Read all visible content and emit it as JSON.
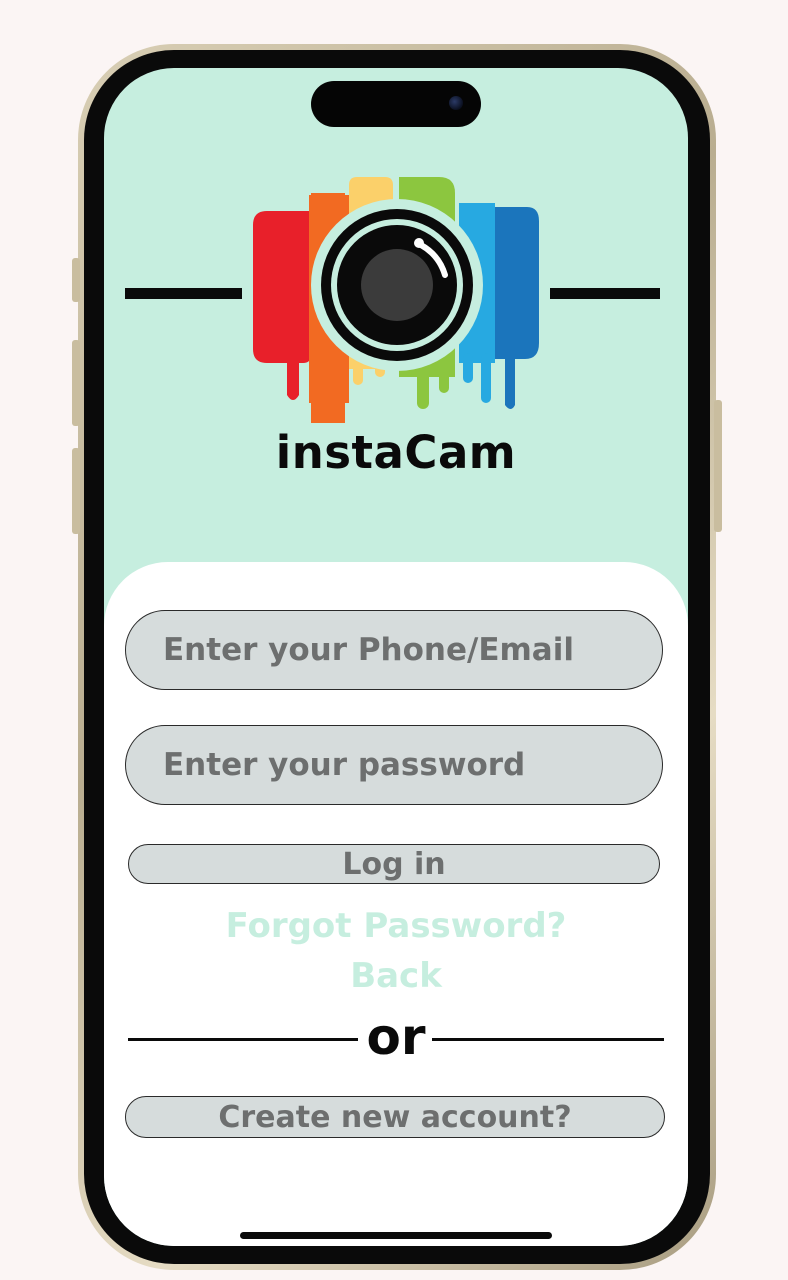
{
  "app": {
    "brand_name": "instaCam",
    "logo": "rainbow-camera-logo",
    "colors": {
      "screen_background": "#c6eedf",
      "panel_background": "#ffffff",
      "field_fill": "#d6dcdc",
      "field_text": "#6d6f6f",
      "link_text": "#c6eedf",
      "logo_stripes": [
        "#e8202a",
        "#f26a22",
        "#fbd06a",
        "#8cc63f",
        "#27a9e1",
        "#1b75bc"
      ]
    }
  },
  "login_form": {
    "phone_email_placeholder": "Enter your Phone/Email",
    "password_placeholder": "Enter your password",
    "login_label": "Log in",
    "forgot_password_label": "Forgot Password?",
    "back_label": "Back",
    "divider_label": "or",
    "create_account_label": "Create new account?"
  }
}
